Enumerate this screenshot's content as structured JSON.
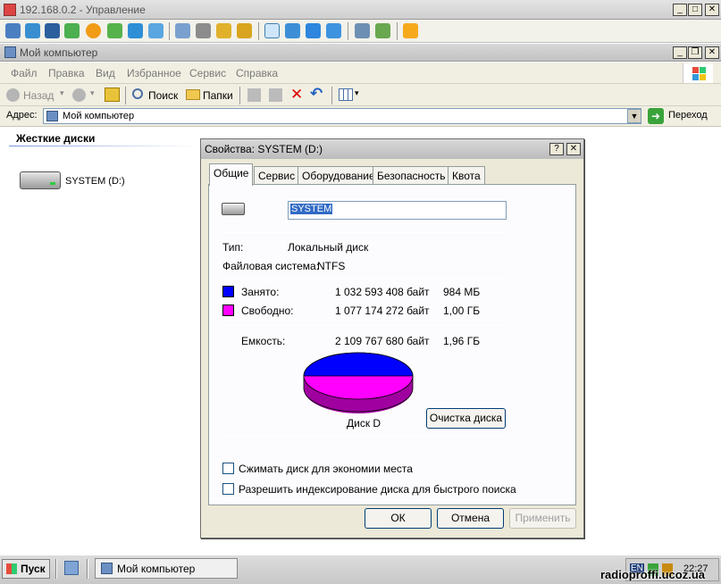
{
  "remote_window": {
    "title": "192.168.0.2 - Управление",
    "controls": {
      "minimize": "_",
      "restore": "□",
      "close": "✕"
    }
  },
  "explorer": {
    "title": "Мой компьютер",
    "menu": [
      "Файл",
      "Правка",
      "Вид",
      "Избранное",
      "Сервис",
      "Справка"
    ],
    "toolbar": {
      "back": "Назад",
      "forward": "",
      "search": "Поиск",
      "folders": "Папки"
    },
    "address": {
      "label": "Адрес:",
      "value": "Мой компьютер",
      "go": "Переход"
    },
    "section_header": "Жесткие диски",
    "drive_label": "SYSTEM (D:)"
  },
  "dialog": {
    "title": "Свойства: SYSTEM (D:)",
    "help": "?",
    "close": "✕",
    "tabs": [
      "Общие",
      "Сервис",
      "Оборудование",
      "Безопасность",
      "Квота"
    ],
    "active_tab": "Общие",
    "volume_name": "SYSTEM",
    "type_label": "Тип:",
    "type_value": "Локальный диск",
    "fs_label": "Файловая система:",
    "fs_value": "NTFS",
    "used": {
      "label": "Занято:",
      "bytes": "1 032 593 408 байт",
      "short": "984 МБ",
      "color": "#0000ff"
    },
    "free": {
      "label": "Свободно:",
      "bytes": "1 077 174 272 байт",
      "short": "1,00 ГБ",
      "color": "#ff00ff"
    },
    "capacity": {
      "label": "Емкость:",
      "bytes": "2 109 767 680 байт",
      "short": "1,96 ГБ"
    },
    "disk_label": "Диск D",
    "cleanup_button": "Очистка диска",
    "compress_label": "Сжимать диск для экономии места",
    "index_label": "Разрешить индексирование диска для быстрого поиска",
    "ok": "ОК",
    "cancel": "Отмена",
    "apply": "Применить"
  },
  "taskbar": {
    "start": "Пуск",
    "task": "Мой компьютер",
    "lang": "EN",
    "clock": "22:27"
  },
  "watermark": "radioproffi.ucoz.ua"
}
